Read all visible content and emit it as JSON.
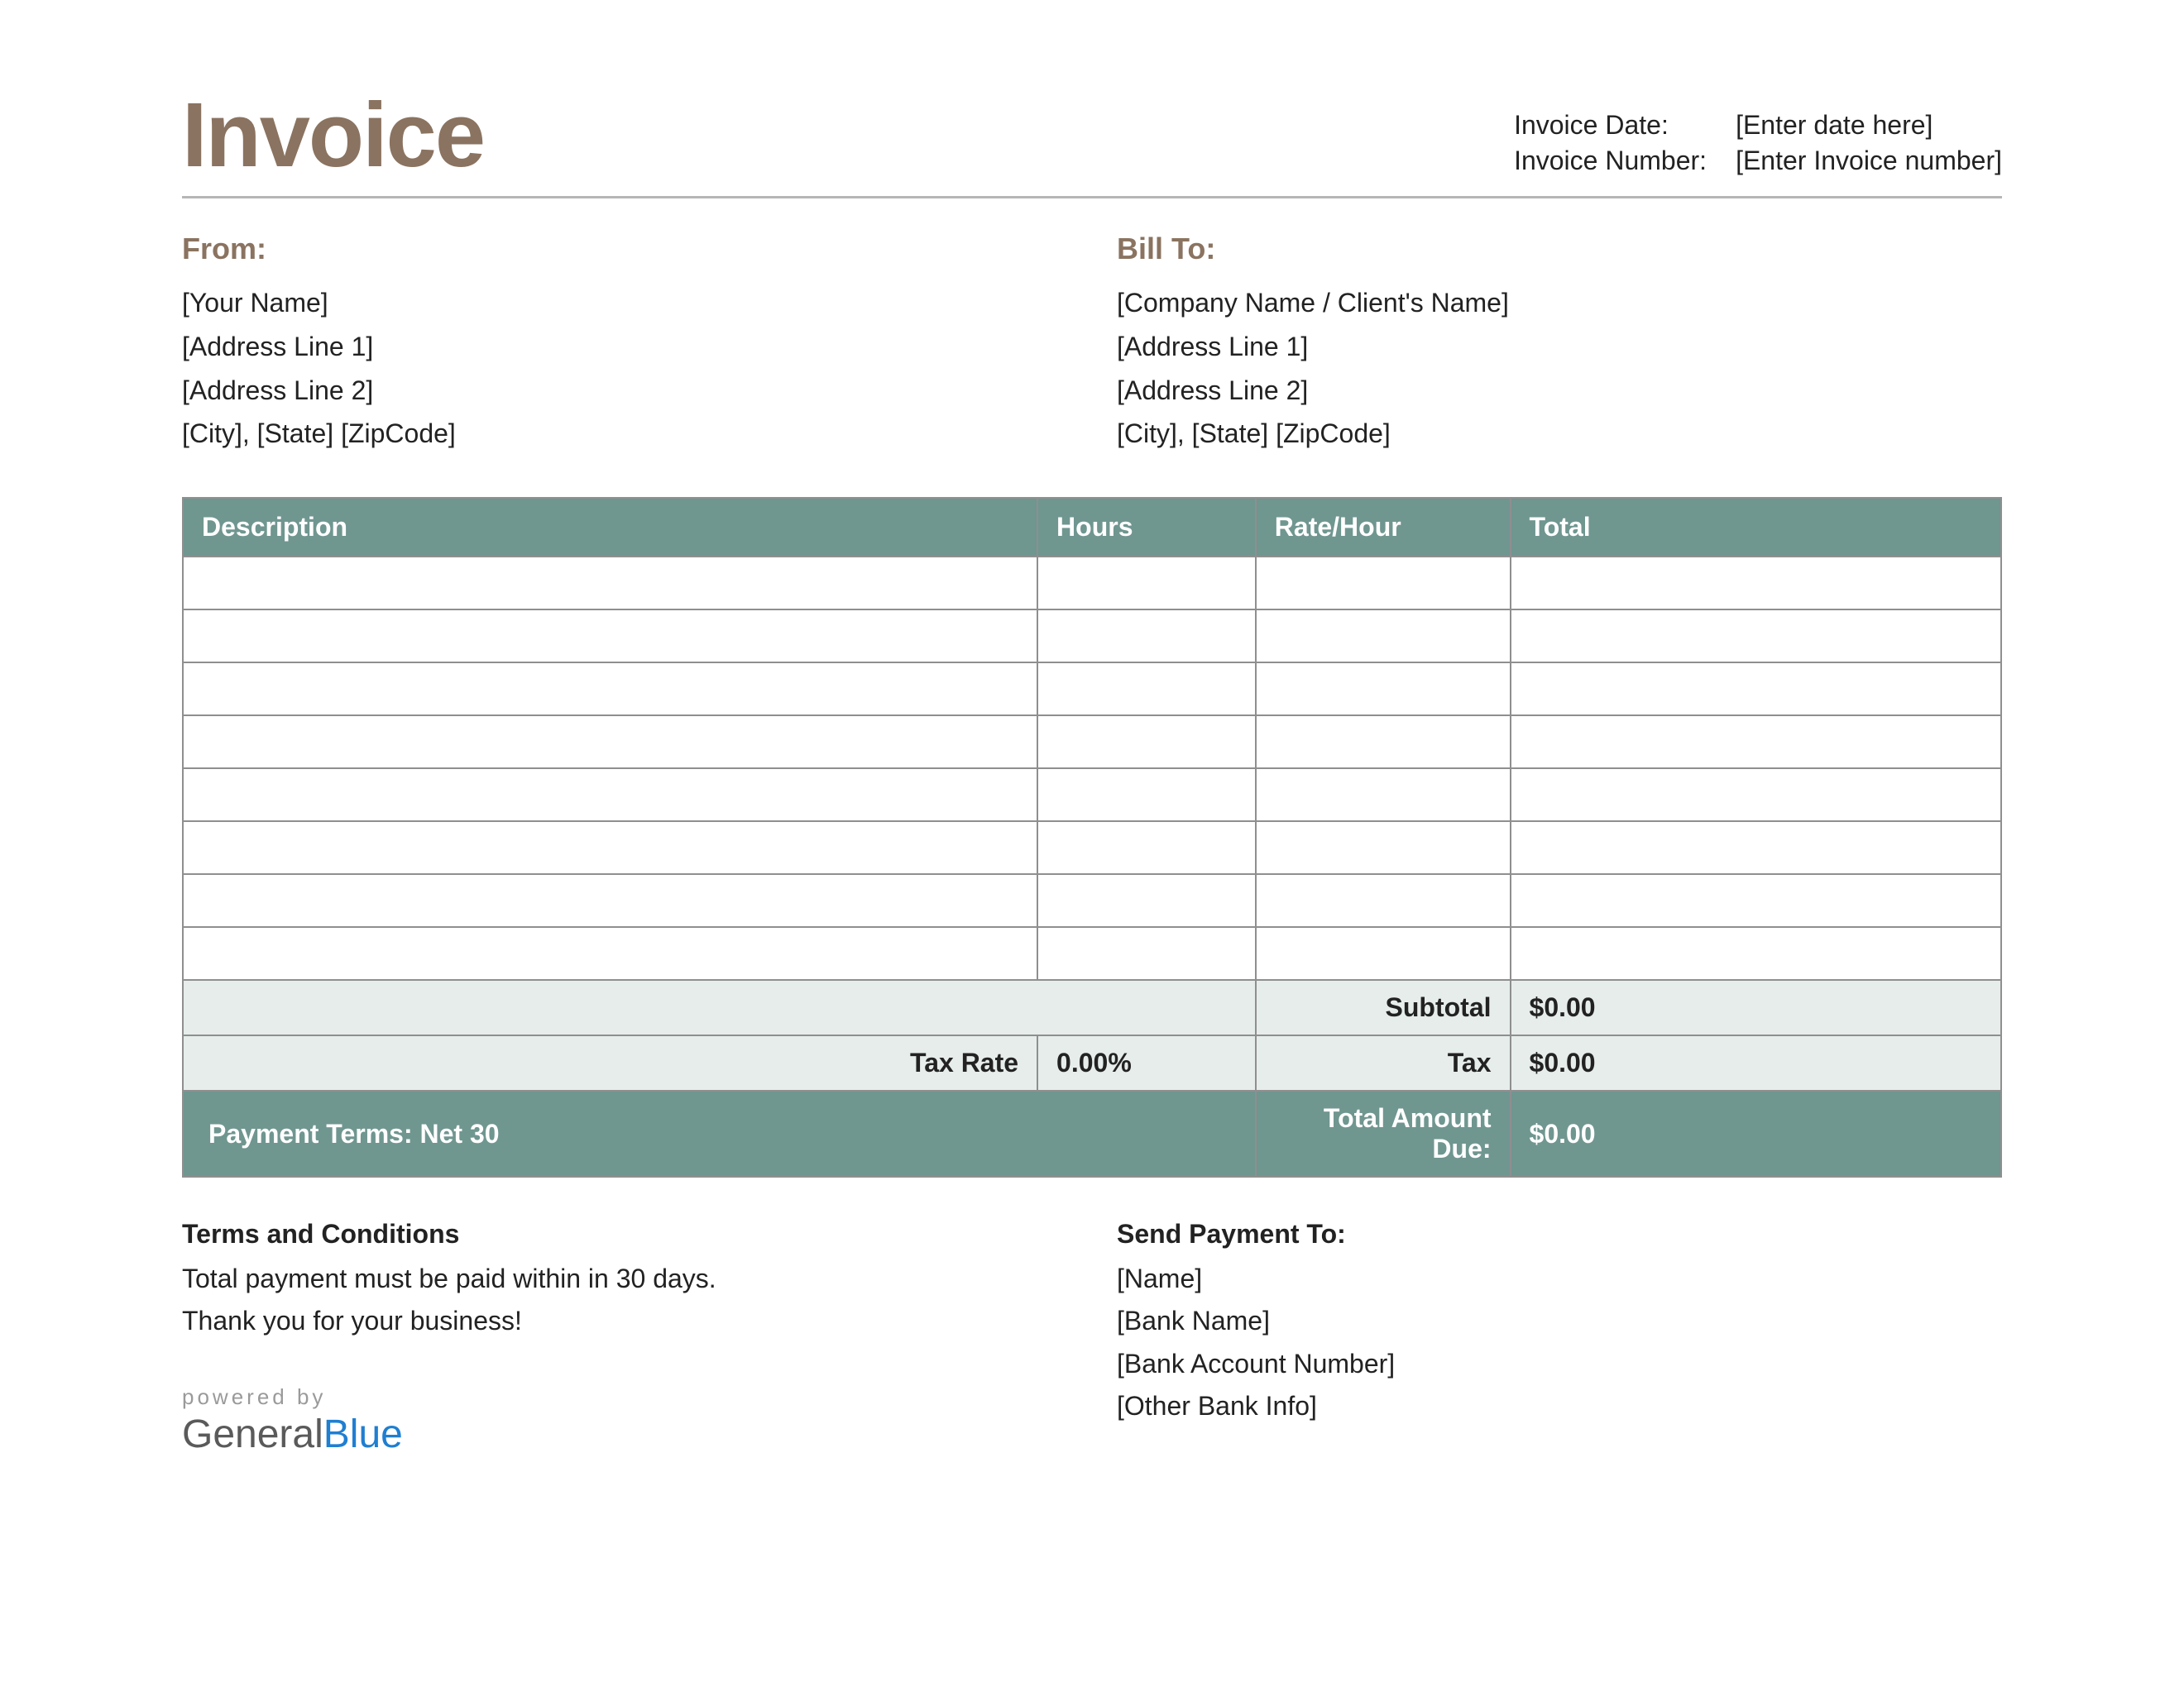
{
  "title": "Invoice",
  "meta": {
    "date_label": "Invoice Date:",
    "date_value": "[Enter date here]",
    "number_label": "Invoice Number:",
    "number_value": "[Enter Invoice number]"
  },
  "from": {
    "heading": "From:",
    "lines": [
      "[Your Name]",
      "[Address Line 1]",
      "[Address Line 2]",
      "[City], [State] [ZipCode]"
    ]
  },
  "billto": {
    "heading": "Bill To:",
    "lines": [
      "[Company Name / Client's Name]",
      "[Address Line 1]",
      "[Address Line 2]",
      "[City], [State] [ZipCode]"
    ]
  },
  "table": {
    "headers": {
      "desc": "Description",
      "hours": "Hours",
      "rate": "Rate/Hour",
      "total": "Total"
    },
    "row_count": 8,
    "subtotal_label": "Subtotal",
    "subtotal_value": "$0.00",
    "taxrate_label": "Tax Rate",
    "taxrate_value": "0.00%",
    "tax_label": "Tax",
    "tax_value": "$0.00",
    "payment_terms": "Payment Terms: Net 30",
    "total_due_label": "Total Amount Due:",
    "total_due_value": "$0.00"
  },
  "terms": {
    "heading": "Terms and Conditions",
    "lines": [
      "Total payment must be paid within in 30 days.",
      "Thank you for your business!"
    ]
  },
  "payment": {
    "heading": "Send Payment To:",
    "lines": [
      "[Name]",
      "[Bank Name]",
      "[Bank Account Number]",
      "[Other Bank Info]"
    ]
  },
  "brand": {
    "powered": "powered by",
    "part1": "General",
    "part2": "Blue"
  }
}
